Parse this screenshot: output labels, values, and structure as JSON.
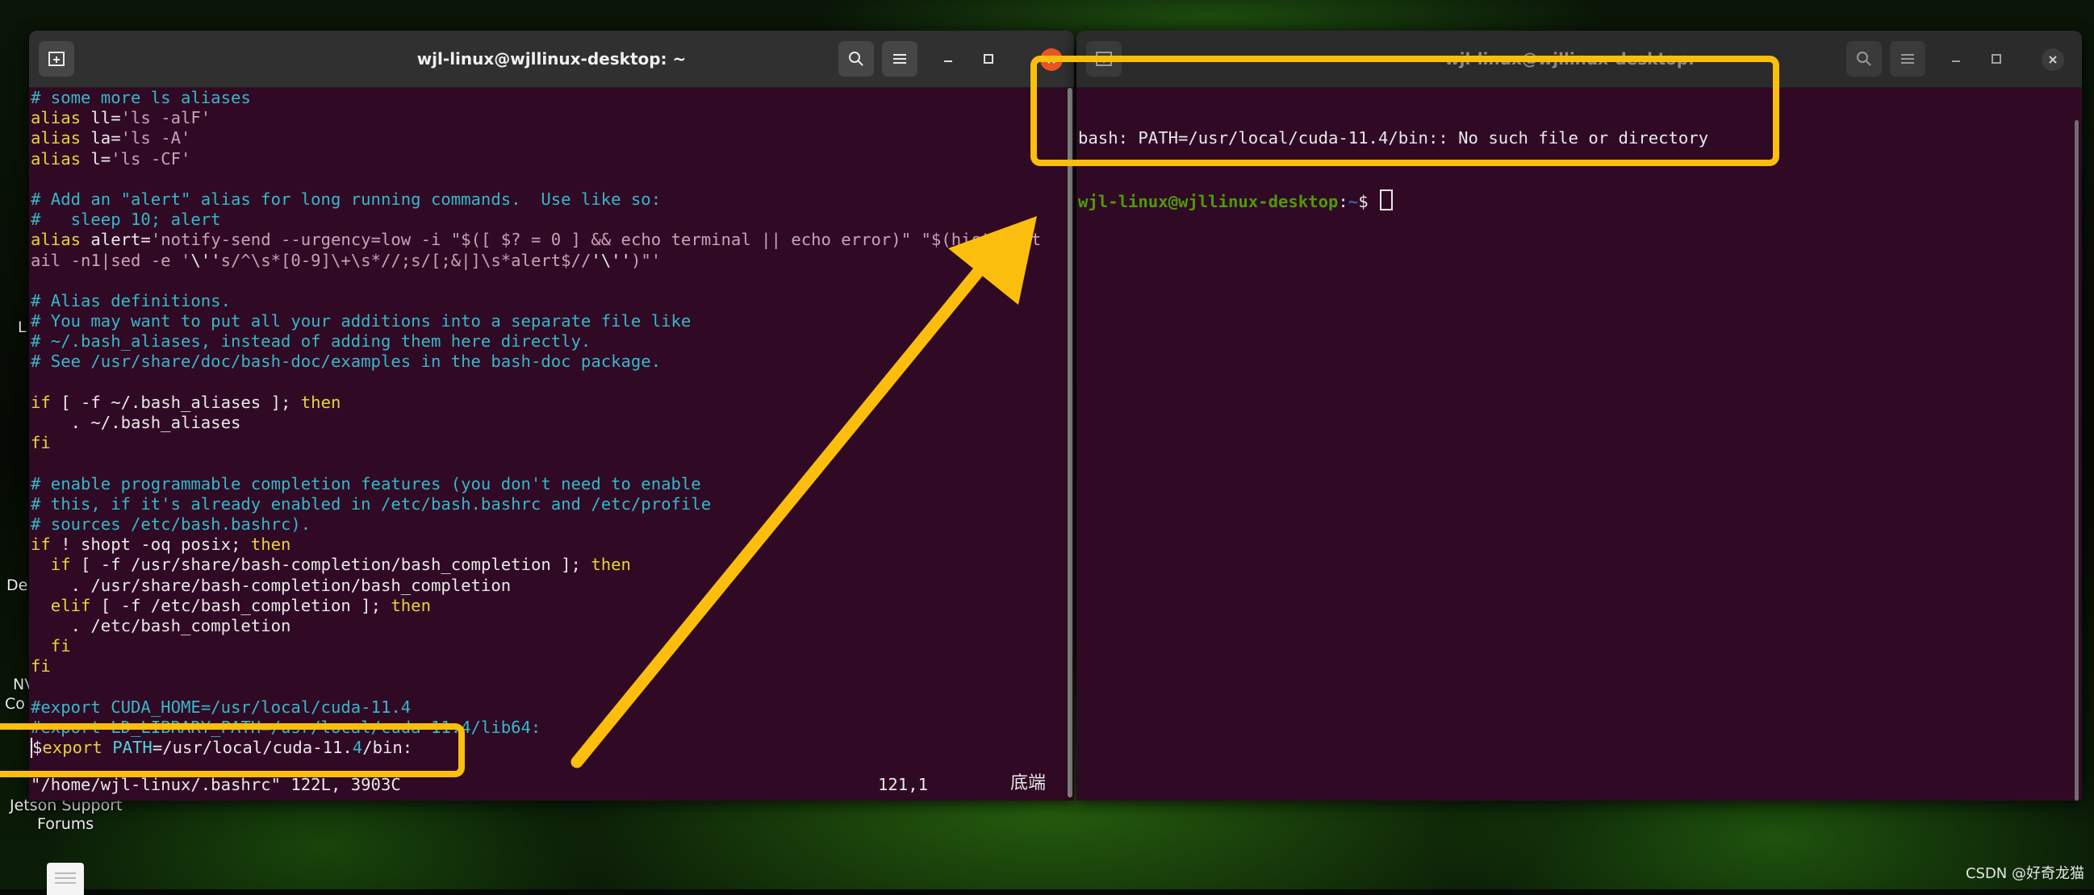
{
  "desktop": {
    "labels": [
      "L",
      "De",
      "NV",
      "Co",
      "Jetson Support",
      "Forums"
    ],
    "watermark": "CSDN @好奇龙猫"
  },
  "left_window": {
    "title": "wjl-linux@wjllinux-desktop: ~",
    "lines": [
      [
        [
          "c-com",
          "# some more ls aliases"
        ]
      ],
      [
        [
          "c-kw",
          "alias "
        ],
        [
          "",
          "ll="
        ],
        [
          "c-str",
          "'ls -alF'"
        ]
      ],
      [
        [
          "c-kw",
          "alias "
        ],
        [
          "",
          "la="
        ],
        [
          "c-str",
          "'ls -A'"
        ]
      ],
      [
        [
          "c-kw",
          "alias "
        ],
        [
          "",
          "l="
        ],
        [
          "c-str",
          "'ls -CF'"
        ]
      ],
      [],
      [
        [
          "c-com",
          "# Add an \"alert\" alias for long running commands.  Use like so:"
        ]
      ],
      [
        [
          "c-com",
          "#   sleep 10; alert"
        ]
      ],
      [
        [
          "c-kw",
          "alias "
        ],
        [
          "",
          "alert="
        ],
        [
          "c-str",
          "'notify-send --urgency=low -i \"$([ $? = 0 ] && echo terminal || echo error)\" \"$(history|t"
        ]
      ],
      [
        [
          "c-str",
          "ail -n1|sed -e '"
        ],
        [
          "",
          "\\''"
        ],
        [
          "c-str",
          "s/^\\s*[0-9]\\+\\s*//;s/[;&|]\\s*alert$//"
        ],
        [
          "",
          "'\\''"
        ],
        [
          "c-str",
          ")\"'"
        ]
      ],
      [],
      [
        [
          "c-com",
          "# Alias definitions."
        ]
      ],
      [
        [
          "c-com",
          "# You may want to put all your additions into a separate file like"
        ]
      ],
      [
        [
          "c-com",
          "# ~/.bash_aliases, instead of adding them here directly."
        ]
      ],
      [
        [
          "c-com",
          "# See /usr/share/doc/bash-doc/examples in the bash-doc package."
        ]
      ],
      [],
      [
        [
          "c-kw",
          "if"
        ],
        [
          "",
          " [ -f ~/.bash_aliases ]; "
        ],
        [
          "c-kw",
          "then"
        ]
      ],
      [
        [
          "",
          "    . ~/.bash_aliases"
        ]
      ],
      [
        [
          "c-kw",
          "fi"
        ]
      ],
      [],
      [
        [
          "c-com",
          "# enable programmable completion features (you don't need to enable"
        ]
      ],
      [
        [
          "c-com",
          "# this, if it's already enabled in /etc/bash.bashrc and /etc/profile"
        ]
      ],
      [
        [
          "c-com",
          "# sources /etc/bash.bashrc)."
        ]
      ],
      [
        [
          "c-kw",
          "if"
        ],
        [
          "",
          " ! shopt -oq posix; "
        ],
        [
          "c-kw",
          "then"
        ]
      ],
      [
        [
          "c-kw",
          "  if"
        ],
        [
          "",
          " [ -f /usr/share/bash-completion/bash_completion ]; "
        ],
        [
          "c-kw",
          "then"
        ]
      ],
      [
        [
          "",
          "    . /usr/share/bash-completion/bash_completion"
        ]
      ],
      [
        [
          "c-kw",
          "  elif"
        ],
        [
          "",
          " [ -f /etc/bash_completion ]; "
        ],
        [
          "c-kw",
          "then"
        ]
      ],
      [
        [
          "",
          "    . /etc/bash_completion"
        ]
      ],
      [
        [
          "c-kw",
          "  fi"
        ]
      ],
      [
        [
          "c-kw",
          "fi"
        ]
      ],
      [],
      [
        [
          "c-com",
          "#export CUDA_HOME=/usr/local/cuda-11.4"
        ]
      ],
      [
        [
          "c-com",
          "#export LD_LIBRARY_PATH=/usr/local/cuda-11.4/lib64:"
        ]
      ],
      [
        [
          "cursor",
          "$"
        ],
        [
          "c-kw",
          "export "
        ],
        [
          "c-var",
          "PATH"
        ],
        [
          "",
          "=/usr/local/cuda-11."
        ],
        [
          "c-com",
          "4"
        ],
        [
          "",
          "/bin:"
        ]
      ]
    ],
    "status_file": "\"/home/wjl-linux/.bashrc\" 122L, 3903C",
    "status_pos": "121,1",
    "status_mode": "底端"
  },
  "right_window": {
    "title": "wjl-linux@wjllinux-desktop: ~",
    "error_line": "bash: PATH=/usr/local/cuda-11.4/bin:: No such file or directory",
    "prompt_user": "wjl-linux@wjllinux-desktop",
    "prompt_path": "~",
    "prompt_symbol": "$"
  },
  "icons": {
    "new_tab": "new-tab-icon",
    "search": "search-icon",
    "menu": "hamburger-menu-icon",
    "minimize": "minimize-icon",
    "maximize": "maximize-icon",
    "close": "close-icon"
  },
  "colors": {
    "terminal_bg": "#300a24",
    "highlight": "#fbbe0c",
    "ubuntu_orange": "#e95420"
  }
}
